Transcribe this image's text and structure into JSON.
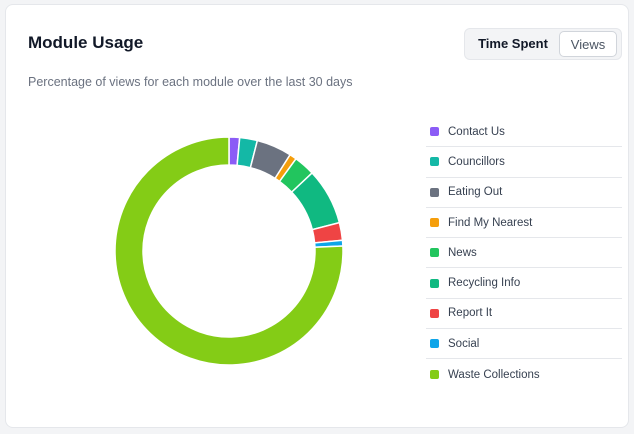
{
  "card": {
    "title": "Module Usage",
    "subtitle": "Percentage of views for each module over the last 30 days"
  },
  "toggle": {
    "time_spent": "Time Spent",
    "views": "Views",
    "selected": "Views"
  },
  "chart_data": {
    "type": "pie",
    "variant": "donut",
    "categories": [
      "Contact Us",
      "Councillors",
      "Eating Out",
      "Find My Nearest",
      "News",
      "Recycling Info",
      "Report It",
      "Social",
      "Waste Collections"
    ],
    "values": [
      1.5,
      2.5,
      5.0,
      1.0,
      3.0,
      8.0,
      2.5,
      0.8,
      75.7
    ],
    "colors": [
      "#8b5cf6",
      "#14b8a6",
      "#6b7280",
      "#f59e0b",
      "#22c55e",
      "#10b981",
      "#ef4444",
      "#0ea5e9",
      "#84cc16"
    ],
    "legend": "right"
  }
}
